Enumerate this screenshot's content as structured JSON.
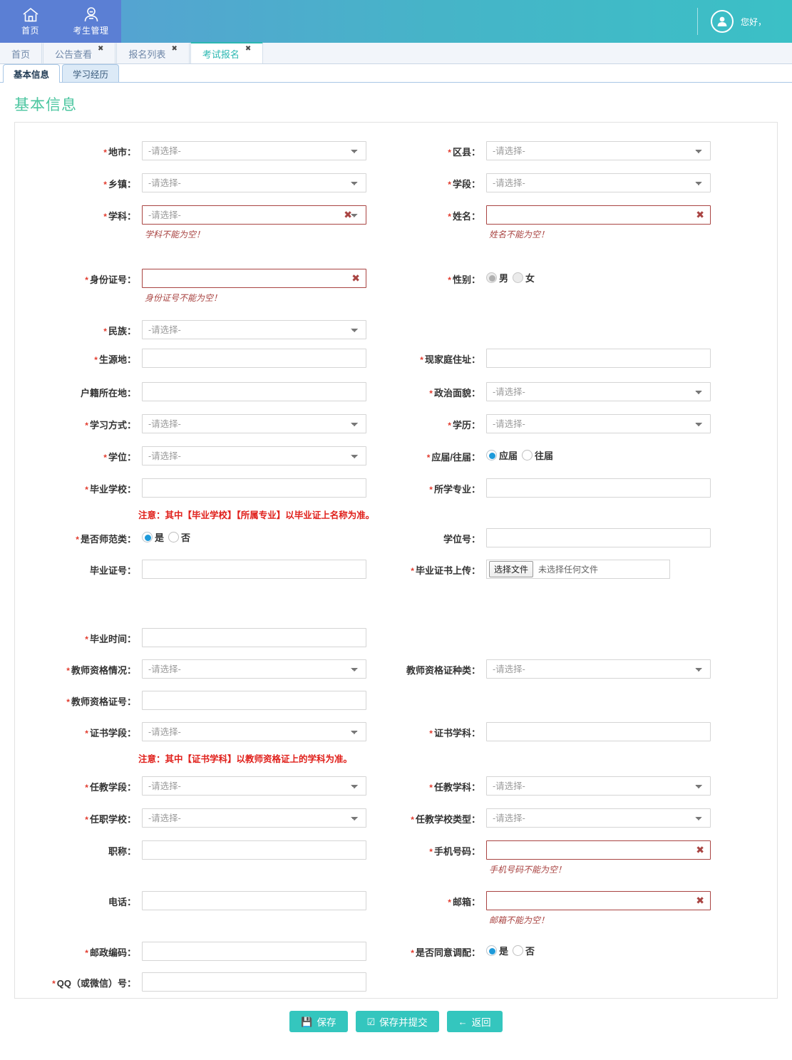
{
  "header": {
    "nav": [
      {
        "label": "首页",
        "icon": "home-icon"
      },
      {
        "label": "考生管理",
        "icon": "user-manage-icon"
      }
    ],
    "greeting": "您好，",
    "avatar_icon": "user-avatar-icon"
  },
  "tabs": [
    {
      "label": "首页",
      "closable": false,
      "active": false
    },
    {
      "label": "公告查看",
      "closable": true,
      "active": false
    },
    {
      "label": "报名列表",
      "closable": true,
      "active": false
    },
    {
      "label": "考试报名",
      "closable": true,
      "active": true
    }
  ],
  "subtabs": [
    {
      "label": "基本信息",
      "active": true
    },
    {
      "label": "学习经历",
      "active": false
    }
  ],
  "page_title": "基本信息",
  "placeholders": {
    "select": "-请选择-"
  },
  "fields": {
    "city": {
      "label": "地市",
      "required": true,
      "type": "select",
      "value": "-请选择-"
    },
    "district": {
      "label": "区县",
      "required": true,
      "type": "select",
      "value": "-请选择-"
    },
    "township": {
      "label": "乡镇",
      "required": true,
      "type": "select",
      "value": "-请选择-"
    },
    "stage": {
      "label": "学段",
      "required": true,
      "type": "select",
      "value": "-请选择-"
    },
    "subject": {
      "label": "学科",
      "required": true,
      "type": "select",
      "value": "-请选择-",
      "error": "学科不能为空！"
    },
    "name": {
      "label": "姓名",
      "required": true,
      "type": "text",
      "value": "",
      "error": "姓名不能为空！"
    },
    "id_number": {
      "label": "身份证号",
      "required": true,
      "type": "text",
      "value": "",
      "error": "身份证号不能为空！"
    },
    "gender": {
      "label": "性别",
      "required": true,
      "type": "radio",
      "options": [
        "男",
        "女"
      ],
      "selected": "男",
      "disabled": true
    },
    "ethnicity": {
      "label": "民族",
      "required": true,
      "type": "select",
      "value": "-请选择-"
    },
    "origin": {
      "label": "生源地",
      "required": true,
      "type": "text",
      "value": ""
    },
    "home_address": {
      "label": "现家庭住址",
      "required": true,
      "type": "text",
      "value": ""
    },
    "household": {
      "label": "户籍所在地",
      "required": false,
      "type": "text",
      "value": ""
    },
    "political": {
      "label": "政治面貌",
      "required": true,
      "type": "select",
      "value": "-请选择-"
    },
    "study_mode": {
      "label": "学习方式",
      "required": true,
      "type": "select",
      "value": "-请选择-"
    },
    "education": {
      "label": "学历",
      "required": true,
      "type": "select",
      "value": "-请选择-"
    },
    "degree": {
      "label": "学位",
      "required": true,
      "type": "select",
      "value": "-请选择-"
    },
    "grad_status": {
      "label": "应届/往届",
      "required": true,
      "type": "radio",
      "options": [
        "应届",
        "往届"
      ],
      "selected": "应届"
    },
    "grad_school": {
      "label": "毕业学校",
      "required": true,
      "type": "text",
      "value": ""
    },
    "major": {
      "label": "所学专业",
      "required": true,
      "type": "text",
      "value": ""
    },
    "is_normal": {
      "label": "是否师范类",
      "required": true,
      "type": "radio",
      "options": [
        "是",
        "否"
      ],
      "selected": "是"
    },
    "degree_no": {
      "label": "学位号",
      "required": false,
      "type": "text",
      "value": ""
    },
    "diploma_no": {
      "label": "毕业证号",
      "required": false,
      "type": "text",
      "value": ""
    },
    "cert_upload": {
      "label": "毕业证书上传",
      "required": true,
      "type": "file",
      "button": "选择文件",
      "status": "未选择任何文件"
    },
    "grad_time": {
      "label": "毕业时间",
      "required": true,
      "type": "text",
      "value": ""
    },
    "teach_cert_stat": {
      "label": "教师资格情况",
      "required": true,
      "type": "select",
      "value": "-请选择-"
    },
    "teach_cert_type": {
      "label": "教师资格证种类",
      "required": false,
      "type": "select",
      "value": "-请选择-"
    },
    "teach_cert_no": {
      "label": "教师资格证号",
      "required": true,
      "type": "text",
      "value": ""
    },
    "cert_stage": {
      "label": "证书学段",
      "required": true,
      "type": "select",
      "value": "-请选择-"
    },
    "cert_subject": {
      "label": "证书学科",
      "required": true,
      "type": "text",
      "value": ""
    },
    "teaching_stage": {
      "label": "任教学段",
      "required": true,
      "type": "select",
      "value": "-请选择-"
    },
    "teaching_subject": {
      "label": "任教学科",
      "required": true,
      "type": "select",
      "value": "-请选择-"
    },
    "work_school": {
      "label": "任职学校",
      "required": true,
      "type": "select",
      "value": "-请选择-"
    },
    "school_type": {
      "label": "任教学校类型",
      "required": true,
      "type": "select",
      "value": "-请选择-"
    },
    "title_rank": {
      "label": "职称",
      "required": false,
      "type": "text",
      "value": ""
    },
    "mobile": {
      "label": "手机号码",
      "required": true,
      "type": "text",
      "value": "",
      "error": "手机号码不能为空！"
    },
    "phone": {
      "label": "电话",
      "required": false,
      "type": "text",
      "value": ""
    },
    "email": {
      "label": "邮箱",
      "required": true,
      "type": "text",
      "value": "",
      "error": "邮箱不能为空！"
    },
    "postcode": {
      "label": "邮政编码",
      "required": true,
      "type": "text",
      "value": ""
    },
    "allow_adjust": {
      "label": "是否同意调配",
      "required": true,
      "type": "radio",
      "options": [
        "是",
        "否"
      ],
      "selected": "是"
    },
    "qq": {
      "label": "QQ（或微信）号",
      "required": true,
      "type": "text",
      "value": ""
    }
  },
  "notes": {
    "note1": "注意：其中【毕业学校】【所属专业】以毕业证上名称为准。",
    "note2": "注意：其中【证书学科】以教师资格证上的学科为准。"
  },
  "footer": {
    "save": {
      "label": "保存",
      "icon": "floppy-save-icon"
    },
    "save_submit": {
      "label": "保存并提交",
      "icon": "check-square-icon"
    },
    "back": {
      "label": "返回",
      "icon": "arrow-left-icon"
    }
  },
  "colors": {
    "header_blue": "#5b7fd4",
    "header_teal": "#3bc0c6",
    "accent_teal": "#34c6be",
    "title_green": "#4cc6a0",
    "error_red": "#a94442",
    "note_red": "#e0201b",
    "radio_blue": "#1e9ada"
  }
}
